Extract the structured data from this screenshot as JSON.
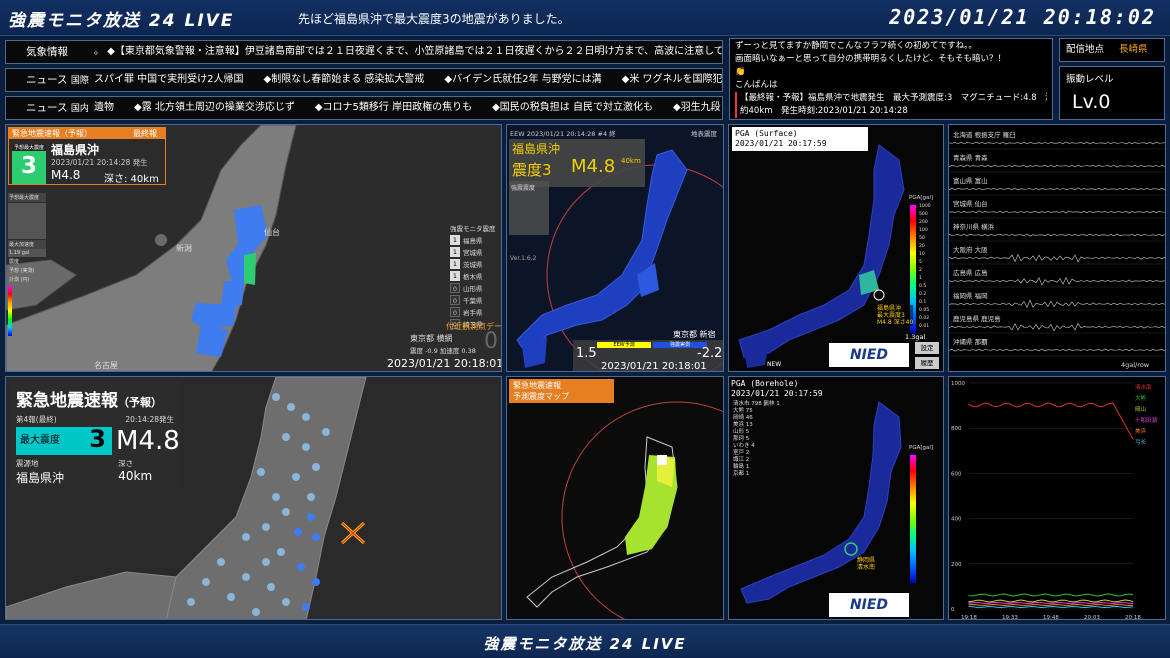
{
  "header": {
    "station_title": "強震モニタ放送 24 LIVE",
    "message": "先ほど福島県沖で最大震度3の地震がありました。",
    "clock": "2023/01/21 20:18:02"
  },
  "tickers": [
    {
      "label": "気象情報",
      "label_en": "",
      "text": "。 ◆【東京都気象警報・注意報】伊豆諸島南部では２１日夜遅くまで、小笠原諸島では２１日夜遅くから２２日明け方まで、高波に注意してくだ"
    },
    {
      "label": "ニュース",
      "label_en": "国際",
      "text": "スパイ罪 中国で実刑受け2人帰国　　◆制限なし春節始まる 感染拡大警戒　　◆バイデン氏就任2年 与野党には溝　　◆米 ワグネルを国際犯罪組"
    },
    {
      "label": "ニュース",
      "label_en": "国内",
      "text": "遺物　　◆露 北方領土周辺の操業交渉応じず　　◆コロナ5類移行 岸田政権の焦りも　　◆国民の税負担は 自民で対立激化も　　◆羽生九段"
    }
  ],
  "chat": {
    "lines": [
      {
        "text": "ずーっと見てますか静岡でこんなフラフ続くの初めてですね。。",
        "alert": false
      },
      {
        "text": "画面暗いなぁーと思って自分の携帯明るくしたけど、そもそも暗い？！",
        "alert": false
      },
      {
        "text": "👏",
        "alert": false
      },
      {
        "text": "こんばんは",
        "alert": false
      },
      {
        "text": "【最終報・予報】福島県沖で地震発生　最大予測震度:3　マグニチュード:4.8　深さ:",
        "alert": true
      },
      {
        "text": "約40km　発生時刻:2023/01/21 20:14:28",
        "alert": true
      }
    ]
  },
  "location": {
    "label": "配信地点",
    "value": "長崎県"
  },
  "level": {
    "label": "振動レベル",
    "value": "Lv.0"
  },
  "panel1": {
    "head_left": "緊急地震速報（予報）",
    "head_right": "最終報",
    "intensity_label": "予想最大震度",
    "intensity": "3",
    "region": "福島県沖",
    "origin_time": "2023/01/21 20:14:28 発生",
    "magnitude": "M4.8",
    "depth": "深さ: 40km",
    "side_labels": [
      "予想最大震度",
      "最大加速度",
      "1.19 gal",
      "震度",
      "予想 (実測)",
      "計測 (円)"
    ],
    "cities": [
      "仙台",
      "新潟"
    ],
    "legend_title": "強震モニタ震度",
    "legend": [
      {
        "level": "1",
        "pref": "福島県"
      },
      {
        "level": "1",
        "pref": "宮城県"
      },
      {
        "level": "1",
        "pref": "茨城県"
      },
      {
        "level": "1",
        "pref": "栃木県"
      },
      {
        "level": "0",
        "pref": "山形県"
      },
      {
        "level": "0",
        "pref": "千葉県"
      },
      {
        "level": "0",
        "pref": "岩手県"
      },
      {
        "level": "0",
        "pref": "埼玉県"
      }
    ],
    "nearby": "付近観測点データ",
    "nearby_station": "東京都 横網",
    "nearby_values": "震度 -0.9  加速度 0.38",
    "nearby_big": "0",
    "nearby_city": "名古屋",
    "timestamp": "2023/01/21 20:18:01"
  },
  "panel2": {
    "header": "EEW 2023/01/21 20:14:28 #4 終",
    "corner": "地表震度",
    "region": "福島県沖",
    "intensity": "震度3",
    "magnitude": "M4.8",
    "depth": "40km",
    "sub_label": "強震震度",
    "version": "Ver.1.6.2",
    "station": "東京都 新宿",
    "legend_left": "EEW予測",
    "legend_right": "強震実測",
    "value_left": "1.5",
    "value_right": "-2.2",
    "timestamp": "2023/01/21 20:18:01"
  },
  "panel3": {
    "title": "PGA (Surface)",
    "timestamp": "2023/01/21 20:17:59",
    "scale_title": "PGA[gal]",
    "scale": [
      "1000",
      "500",
      "200",
      "100",
      "50",
      "20",
      "10",
      "5",
      "2",
      "1",
      "0.5",
      "0.2",
      "0.1",
      "0.05",
      "0.02",
      "0.01"
    ],
    "annot": [
      "福島県沖",
      "最大震度3",
      "M4.8 深さ40"
    ],
    "value": "1.3gal",
    "btn_settings": "設定",
    "btn_history": "履歴",
    "new_label": "NEW",
    "logo": "NIED"
  },
  "panel4": {
    "stations": [
      "北海道 根振支庁 羅臼",
      "青森県 青森",
      "富山県 富山",
      "宮城県 仙台",
      "神奈川県 横浜",
      "大阪府 大阪",
      "広島県 広島",
      "福岡県 福岡",
      "鹿児島県 鹿児島",
      "沖縄県 那覇"
    ],
    "scale": "4gal/row"
  },
  "panel5": {
    "title": "緊急地震速報",
    "title_sub": "（予報）",
    "report": "第4報(最終)",
    "report_time": "20:14:28発生",
    "max_label": "最大震度",
    "max_value": "3",
    "magnitude": "M4.8",
    "epi_label": "震源地",
    "epi_value": "福島県沖",
    "depth_label": "深さ",
    "depth_value": "40km"
  },
  "panel6": {
    "title_line1": "緊急地震速報",
    "title_line2": "予測震度マップ"
  },
  "panel7": {
    "title": "PGA (Borehole)",
    "timestamp": "2023/01/21 20:17:59",
    "ranking": [
      "清水市 798  鶴林 1",
      "大熊 75",
      "岡崎 46",
      "美浜 13",
      "山形 5",
      "那珂 5",
      "いわき 4",
      "室戸 2",
      "諏江 2",
      "輪島 1",
      "京都 1"
    ],
    "scale_title": "PGA[gal]",
    "annot": [
      "静岡県",
      "清水南"
    ],
    "logo": "NIED"
  },
  "panel8": {
    "y_labels": [
      "1000",
      "800",
      "600",
      "400",
      "200",
      "0"
    ],
    "x_labels": [
      "19:18",
      "19:33",
      "19:48",
      "20:03",
      "20:18"
    ],
    "legend": [
      {
        "name": "清水南",
        "color": "#e03030"
      },
      {
        "name": "大熊",
        "color": "#30c030"
      },
      {
        "name": "岡山",
        "color": "#d0d030"
      },
      {
        "name": "十和田湖",
        "color": "#e040e0"
      },
      {
        "name": "美浜",
        "color": "#f08030"
      },
      {
        "name": "弓长",
        "color": "#40c0f0"
      }
    ]
  },
  "footer": {
    "title": "強震モニタ放送 24 LIVE"
  }
}
